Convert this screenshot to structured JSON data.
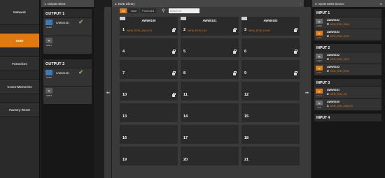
{
  "sidebar": {
    "items": [
      {
        "label": "Network",
        "active": false
      },
      {
        "label": "EDID",
        "active": true
      },
      {
        "label": "Functions",
        "active": false
      },
      {
        "label": "Cross-Memories",
        "active": false
      },
      {
        "label": "Factory Reset",
        "active": false
      }
    ]
  },
  "outputs_panel": {
    "title": "1. Outputs EDID",
    "groups": [
      {
        "title": "OUTPUT 1",
        "rows": [
          {
            "port": "HDMI",
            "kind": "hdmi",
            "name": "IVM0510D",
            "checked": true
          },
          {
            "port": "HDBT",
            "kind": "hdbt",
            "name": "",
            "checked": false
          }
        ]
      },
      {
        "title": "OUTPUT 2",
        "rows": [
          {
            "port": "HDMI",
            "kind": "hdmi",
            "name": "IVM0510D",
            "checked": true
          },
          {
            "port": "HDBT",
            "kind": "hdbt",
            "name": "",
            "checked": false
          }
        ]
      }
    ]
  },
  "library": {
    "title": "2. EDID Library",
    "filters": [
      "All",
      "Valid",
      "Protected"
    ],
    "search_placeholder": "search for",
    "slots": [
      {
        "num": "1",
        "name": "AWW0100",
        "sub": "WEM_EDID_ANALOG",
        "locked": true
      },
      {
        "num": "2",
        "name": "AWW0101",
        "sub": "WEM_EDID_DVI",
        "locked": true
      },
      {
        "num": "3",
        "name": "AWW0102",
        "sub": "WEM_EDID_HDMI",
        "locked": true
      },
      {
        "num": "4",
        "name": "",
        "sub": "",
        "locked": true
      },
      {
        "num": "5",
        "name": "",
        "sub": "",
        "locked": true
      },
      {
        "num": "6",
        "name": "",
        "sub": "",
        "locked": true
      },
      {
        "num": "7",
        "name": "",
        "sub": "",
        "locked": true
      },
      {
        "num": "8",
        "name": "",
        "sub": "",
        "locked": true
      },
      {
        "num": "9",
        "name": "",
        "sub": "",
        "locked": true
      },
      {
        "num": "10",
        "name": "",
        "sub": "",
        "locked": true
      },
      {
        "num": "11",
        "name": "",
        "sub": "",
        "locked": false
      },
      {
        "num": "12",
        "name": "",
        "sub": "",
        "locked": false
      },
      {
        "num": "13",
        "name": "",
        "sub": "",
        "locked": false
      },
      {
        "num": "14",
        "name": "",
        "sub": "",
        "locked": false
      },
      {
        "num": "15",
        "name": "",
        "sub": "",
        "locked": false
      },
      {
        "num": "16",
        "name": "",
        "sub": "",
        "locked": false
      },
      {
        "num": "17",
        "name": "",
        "sub": "",
        "locked": false
      },
      {
        "num": "18",
        "name": "",
        "sub": "",
        "locked": false
      },
      {
        "num": "19",
        "name": "",
        "sub": "",
        "locked": false
      },
      {
        "num": "20",
        "name": "",
        "sub": "",
        "locked": false
      },
      {
        "num": "21",
        "name": "",
        "sub": "",
        "locked": false
      }
    ]
  },
  "inputs_panel": {
    "title": "3. Inputs EDID Source",
    "groups": [
      {
        "title": "INPUT 1",
        "rows": [
          {
            "port": "HDMI",
            "box": "grey",
            "lblcolor": "grey",
            "name": "AWW0102",
            "num": "3",
            "sub": "WEM_EDID_HDMI"
          },
          {
            "port": "HDBT",
            "box": "orange",
            "lblcolor": "orange",
            "name": "AWW0102",
            "num": "3",
            "sub": "WEM_EDID_HDMI"
          }
        ]
      },
      {
        "title": "INPUT 2",
        "rows": [
          {
            "port": "HDMI",
            "box": "grey",
            "lblcolor": "grey",
            "name": "AWW0102",
            "num": "3",
            "sub": "WEM_EDID_HDMI"
          },
          {
            "port": "HDBT",
            "box": "orange",
            "lblcolor": "orange",
            "name": "AWW0102",
            "num": "3",
            "sub": "WEM_EDID_HDMI"
          }
        ]
      },
      {
        "title": "INPUT 3",
        "rows": [
          {
            "port": "DVI-D",
            "box": "orange",
            "lblcolor": "orange",
            "name": "AWW0101",
            "num": "2",
            "sub": "WEM_EDID_DVI"
          },
          {
            "port": "VGA",
            "box": "grey",
            "lblcolor": "grey",
            "name": "AWW0100",
            "num": "1",
            "sub": "WEM_EDID_ANALOG"
          }
        ]
      },
      {
        "title": "INPUT 4",
        "rows": []
      }
    ]
  },
  "arrows": {
    "left": "◂◂",
    "right": "▸▸"
  }
}
